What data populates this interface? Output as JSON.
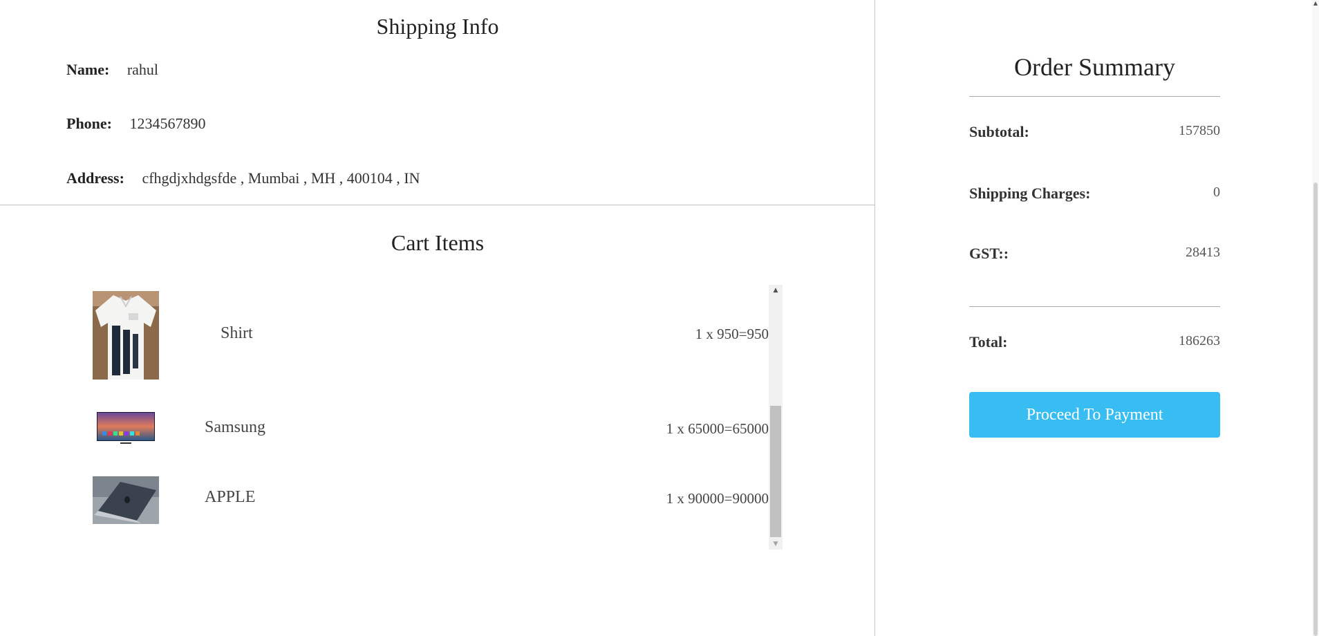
{
  "shipping": {
    "title": "Shipping Info",
    "name_label": "Name:",
    "name_value": "rahul",
    "phone_label": "Phone:",
    "phone_value": "1234567890",
    "address_label": "Address:",
    "address_value": "cfhgdjxhdgsfde , Mumbai , MH , 400104 , IN"
  },
  "cart": {
    "title": "Cart Items",
    "items": [
      {
        "name": "Shirt",
        "price_line": "1 x 950=950",
        "image": "shirt-image"
      },
      {
        "name": "Samsung",
        "price_line": "1 x 65000=65000",
        "image": "tv-image"
      },
      {
        "name": "APPLE",
        "price_line": "1 x 90000=90000",
        "image": "laptop-image"
      }
    ]
  },
  "summary": {
    "title": "Order Summary",
    "subtotal_label": "Subtotal:",
    "subtotal_value": "157850",
    "shipping_label": "Shipping Charges:",
    "shipping_value": "0",
    "gst_label": "GST::",
    "gst_value": "28413",
    "total_label": "Total:",
    "total_value": "186263",
    "pay_button_label": "Proceed To Payment"
  },
  "colors": {
    "pay_button": "#38bdf3",
    "divider": "#c0c0c0"
  },
  "icons": {
    "scroll_up": "scroll-up-arrow-icon",
    "scroll_down": "scroll-down-arrow-icon"
  }
}
